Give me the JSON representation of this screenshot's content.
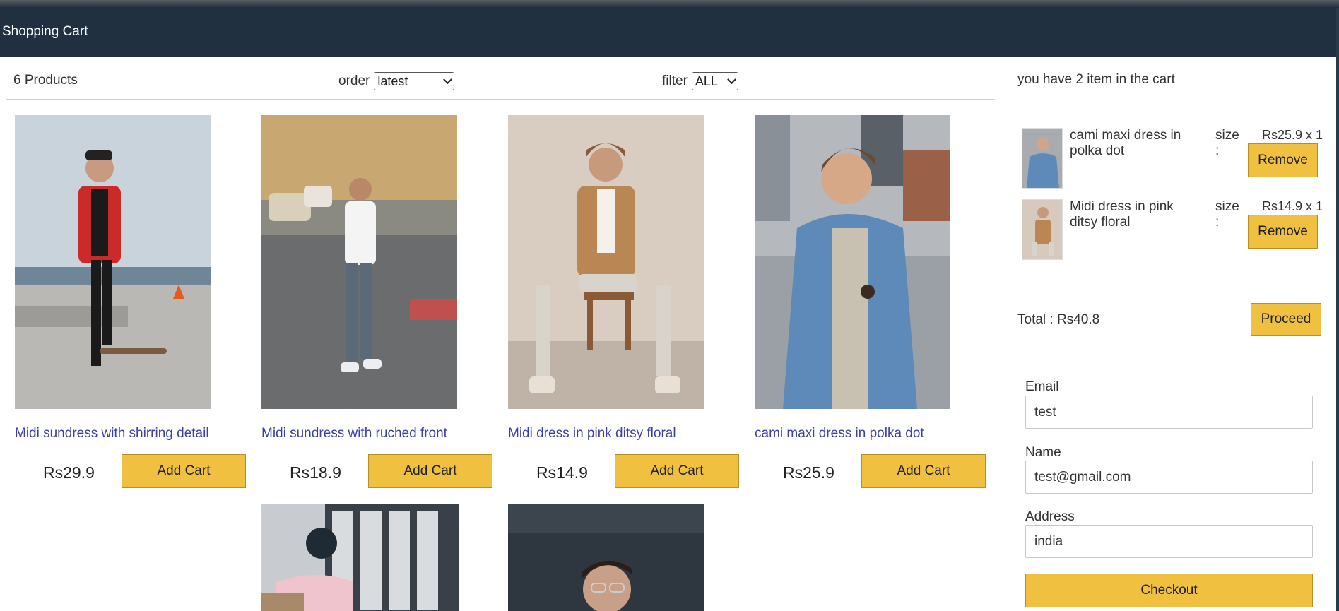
{
  "header": {
    "title": "Shopping Cart"
  },
  "toolbar": {
    "product_count": "6 Products",
    "order_label": "order",
    "order_value": "latest",
    "filter_label": "filter",
    "filter_value": "ALL"
  },
  "products": [
    {
      "name": "Midi sundress with shirring detail",
      "price": "Rs29.9",
      "button": "Add Cart"
    },
    {
      "name": "Midi sundress with ruched front",
      "price": "Rs18.9",
      "button": "Add Cart"
    },
    {
      "name": "Midi dress in pink ditsy floral",
      "price": "Rs14.9",
      "button": "Add Cart"
    },
    {
      "name": "cami maxi dress in polka dot",
      "price": "Rs25.9",
      "button": "Add Cart"
    }
  ],
  "cart": {
    "summary": "you have 2 item in the cart",
    "items": [
      {
        "name": "cami maxi dress in polka dot",
        "size_label": "size :",
        "qty": "Rs25.9 x 1",
        "remove": "Remove"
      },
      {
        "name": "Midi dress in pink ditsy floral",
        "size_label": "size :",
        "qty": "Rs14.9 x 1",
        "remove": "Remove"
      }
    ],
    "total": "Total : Rs40.8",
    "proceed": "Proceed"
  },
  "checkout_form": {
    "email_label": "Email",
    "email_value": "test",
    "name_label": "Name",
    "name_value": "test@gmail.com",
    "address_label": "Address",
    "address_value": "india",
    "checkout": "Checkout"
  },
  "colors": {
    "header_bg": "#203040",
    "accent_button": "#f0c040",
    "product_link": "#3c3fa8"
  }
}
